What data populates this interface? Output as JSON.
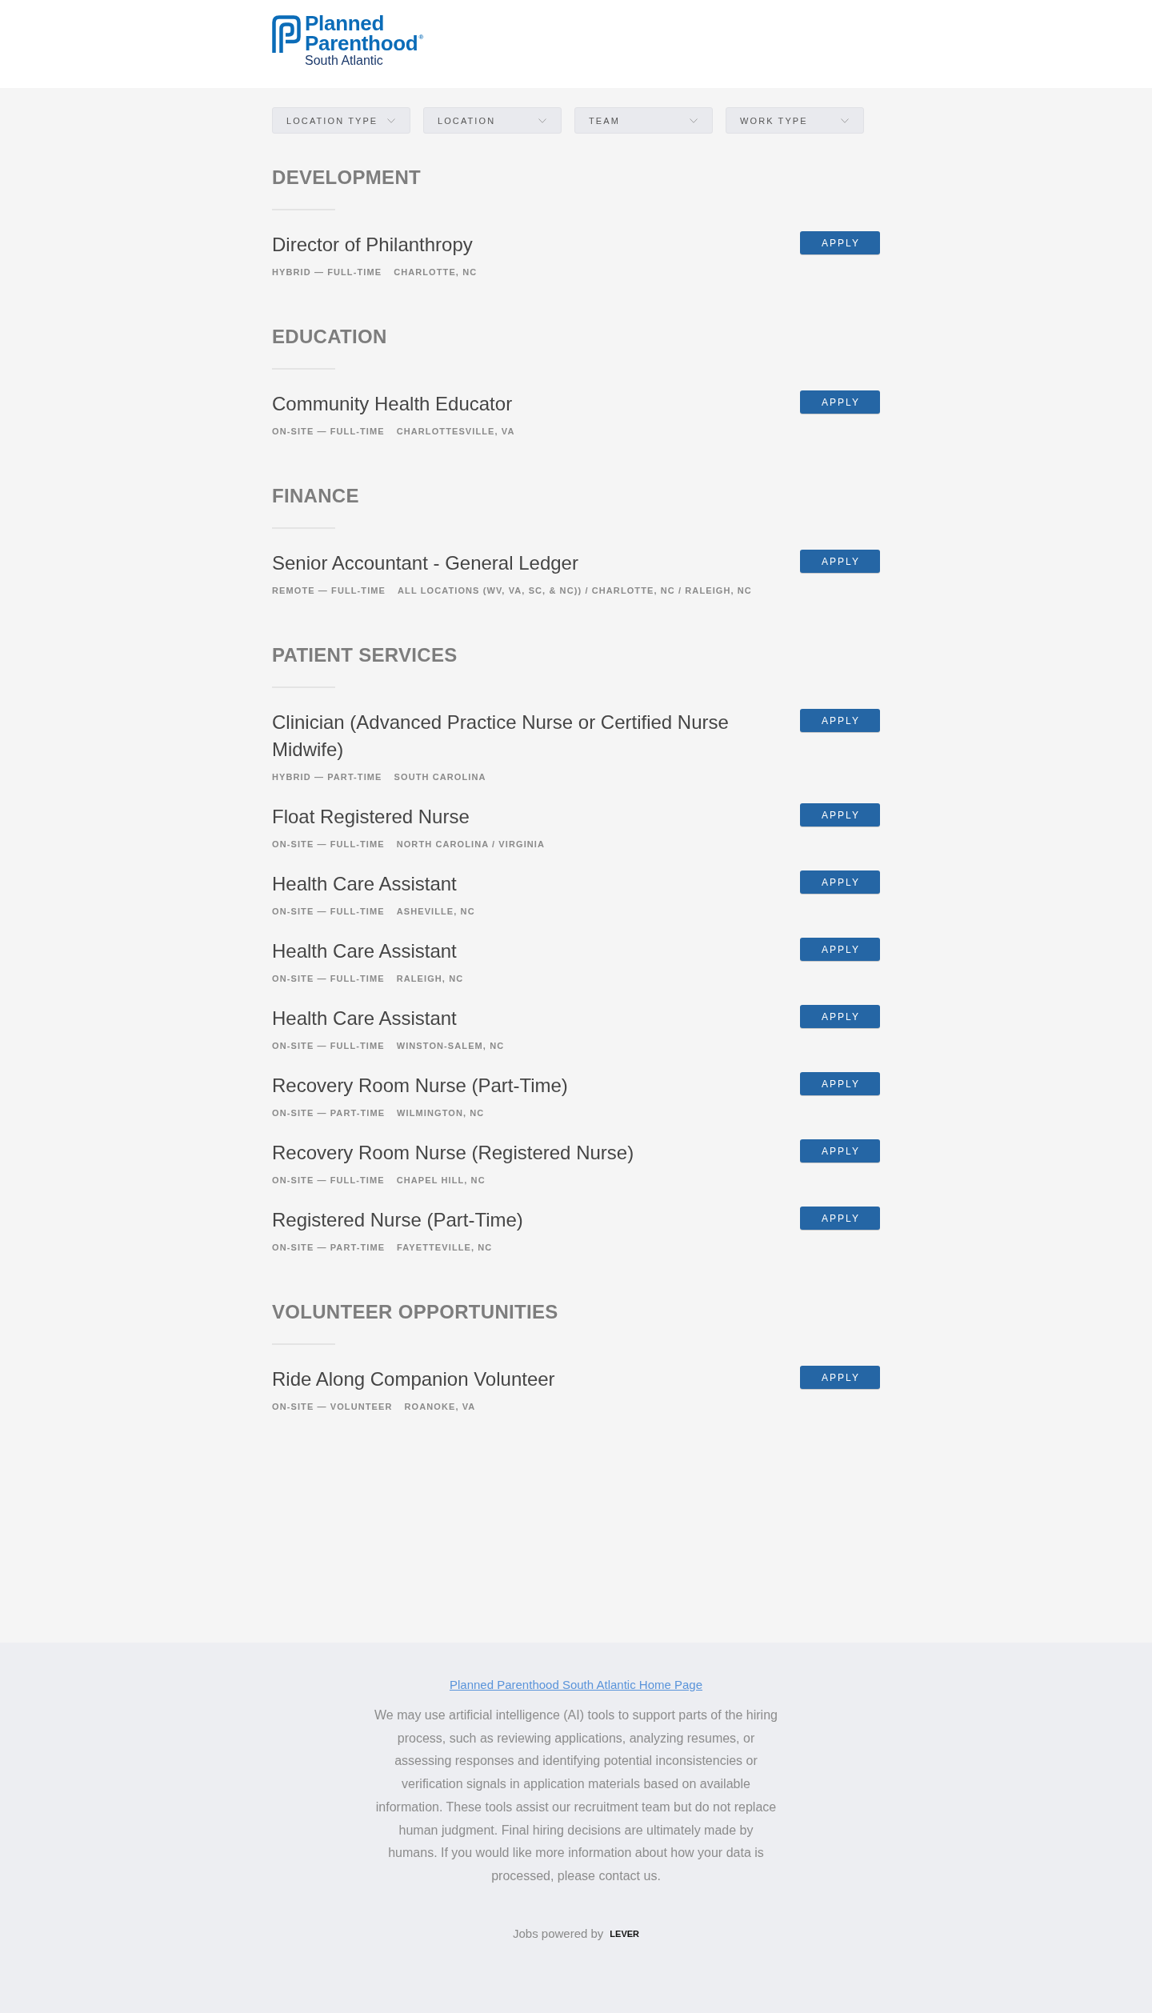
{
  "header": {
    "logo": {
      "title": "Planned Parenthood$^{®}$",
      "subtitle": "South Atlantic"
    }
  },
  "filters": [
    {
      "label": "LOCATION TYPE"
    },
    {
      "label": "LOCATION"
    },
    {
      "label": "TEAM"
    },
    {
      "label": "WORK TYPE"
    }
  ],
  "sections": [
    {
      "title": "DEVELOPMENT",
      "postings": [
        {
          "title": "Director of Philanthropy",
          "commitment": "HYBRID — FULL-TIME",
          "location": "CHARLOTTE, NC",
          "button": "APPLY"
        }
      ]
    },
    {
      "title": "EDUCATION",
      "postings": [
        {
          "title": "Community Health Educator",
          "commitment": "ON-SITE — FULL-TIME",
          "location": "CHARLOTTESVILLE, VA",
          "button": "APPLY"
        }
      ]
    },
    {
      "title": "FINANCE",
      "postings": [
        {
          "title": "Senior Accountant - General Ledger",
          "commitment": "REMOTE — FULL-TIME",
          "location": "ALL LOCATIONS (WV, VA, SC, & NC)) / CHARLOTTE, NC / RALEIGH, NC",
          "button": "APPLY"
        }
      ]
    },
    {
      "title": "PATIENT SERVICES",
      "postings": [
        {
          "title": "Clinician (Advanced Practice Nurse or Certified Nurse Midwife)",
          "commitment": "HYBRID — PART-TIME",
          "location": "SOUTH CAROLINA",
          "button": "APPLY"
        },
        {
          "title": "Float Registered Nurse",
          "commitment": "ON-SITE — FULL-TIME",
          "location": "NORTH CAROLINA / VIRGINIA",
          "button": "APPLY"
        },
        {
          "title": "Health Care Assistant",
          "commitment": "ON-SITE — FULL-TIME",
          "location": "ASHEVILLE, NC",
          "button": "APPLY"
        },
        {
          "title": "Health Care Assistant",
          "commitment": "ON-SITE — FULL-TIME",
          "location": "RALEIGH, NC",
          "button": "APPLY"
        },
        {
          "title": "Health Care Assistant",
          "commitment": "ON-SITE — FULL-TIME",
          "location": "WINSTON-SALEM, NC",
          "button": "APPLY"
        },
        {
          "title": "Recovery Room Nurse (Part-Time)",
          "commitment": "ON-SITE — PART-TIME",
          "location": "WILMINGTON, NC",
          "button": "APPLY"
        },
        {
          "title": "Recovery Room Nurse (Registered Nurse)",
          "commitment": "ON-SITE — FULL-TIME",
          "location": "CHAPEL HILL, NC",
          "button": "APPLY"
        },
        {
          "title": "Registered Nurse (Part-Time)",
          "commitment": "ON-SITE — PART-TIME",
          "location": "FAYETTEVILLE, NC",
          "button": "APPLY"
        }
      ]
    },
    {
      "title": "VOLUNTEER OPPORTUNITIES",
      "postings": [
        {
          "title": "Ride Along Companion Volunteer",
          "commitment": "ON-SITE — VOLUNTEER",
          "location": "ROANOKE, VA",
          "button": "APPLY"
        }
      ]
    }
  ],
  "footer": {
    "home_link": "Planned Parenthood South Atlantic Home Page",
    "disclaimer": "We may use artificial intelligence (AI) tools to support parts of the hiring process, such as reviewing applications, analyzing resumes, or assessing responses and identifying potential inconsistencies or verification signals in application materials based on available information. These tools assist our recruitment team but do not replace human judgment. Final hiring decisions are ultimately made by humans. If you would like more information about how your data is processed, please contact us.",
    "powered_by": "Jobs powered by",
    "powered_by_logo": "LEVER"
  }
}
